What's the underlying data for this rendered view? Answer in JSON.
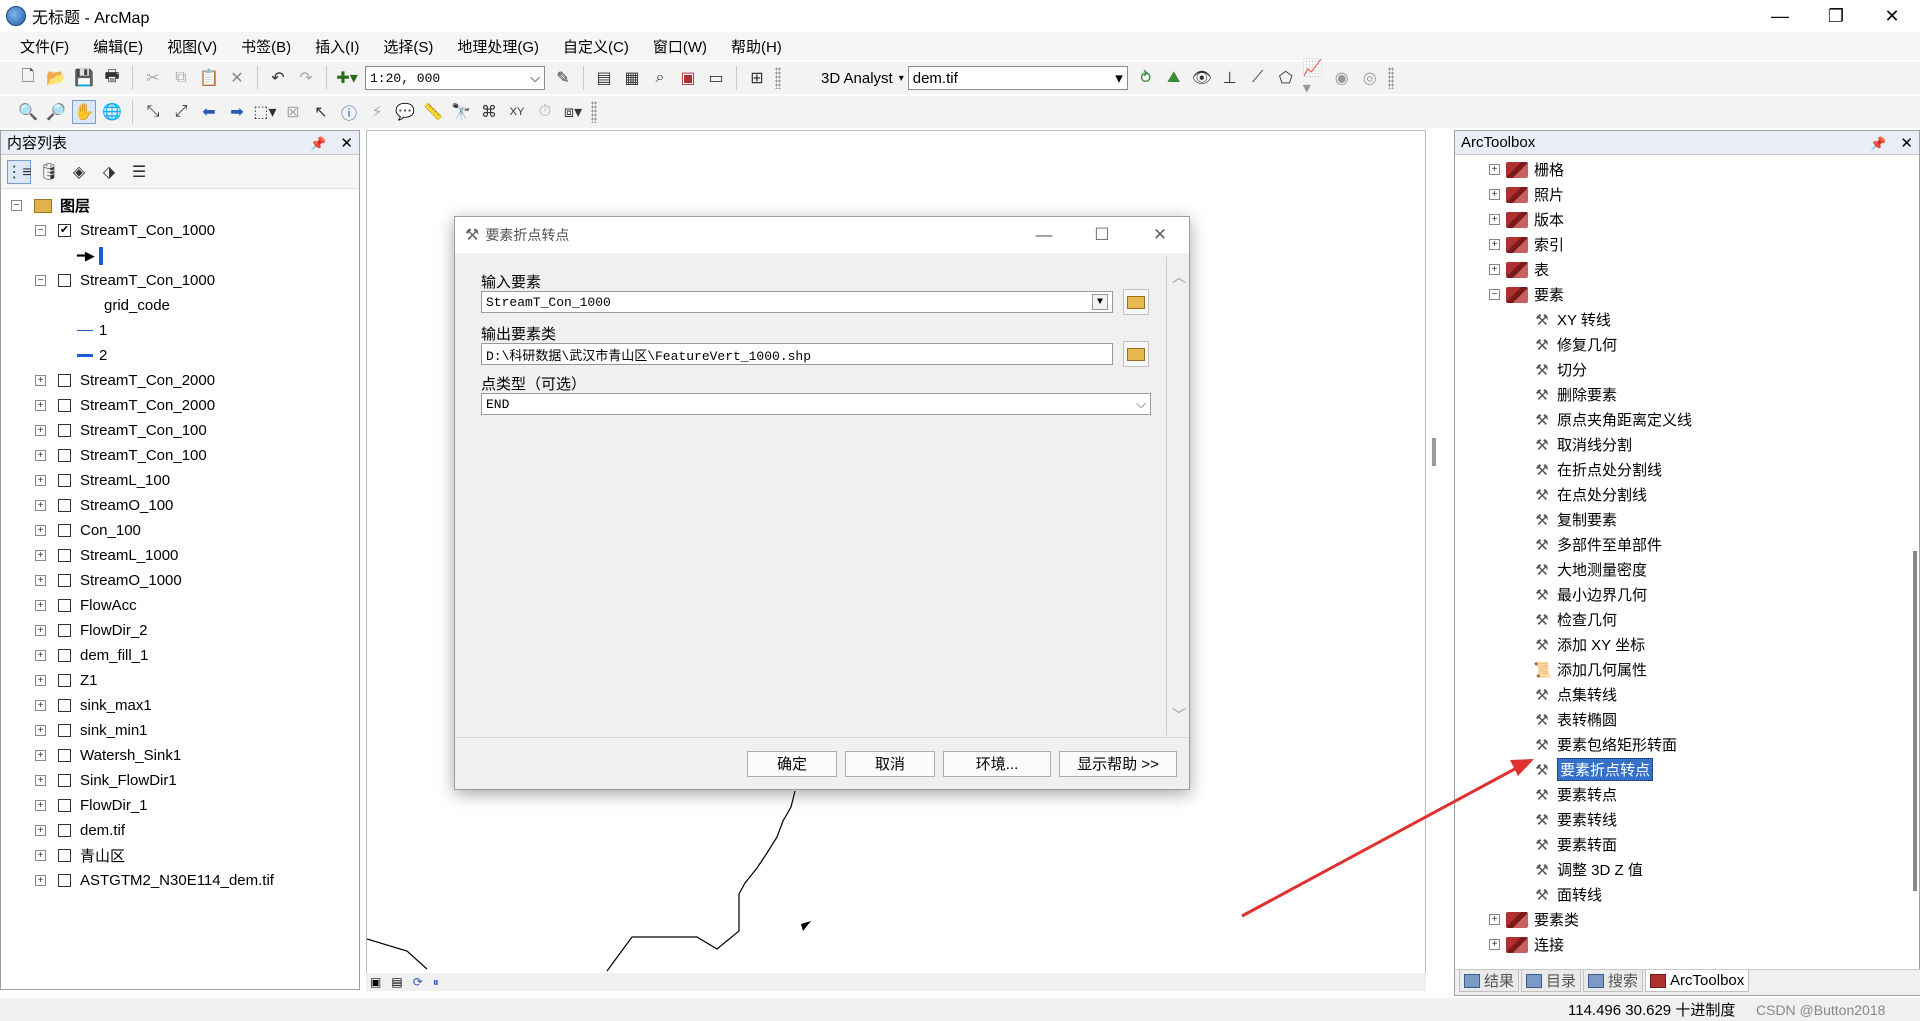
{
  "window": {
    "title": "无标题 - ArcMap",
    "minimize": "—",
    "restore": "❐",
    "close": "✕"
  },
  "menu": [
    "文件(F)",
    "编辑(E)",
    "视图(V)",
    "书签(B)",
    "插入(I)",
    "选择(S)",
    "地理处理(G)",
    "自定义(C)",
    "窗口(W)",
    "帮助(H)"
  ],
  "toolbar": {
    "scale": "1:20, 000",
    "analyst": "3D Analyst",
    "dem_layer": "dem.tif"
  },
  "toc": {
    "title": "内容列表",
    "root": "图层",
    "layers": [
      {
        "name": "StreamT_Con_1000",
        "checked": true,
        "expanded": true
      },
      {
        "name": "StreamT_Con_1000",
        "checked": false,
        "expanded": true
      },
      {
        "name": "StreamT_Con_2000",
        "checked": false
      },
      {
        "name": "StreamT_Con_2000",
        "checked": false
      },
      {
        "name": "StreamT_Con_100",
        "checked": false
      },
      {
        "name": "StreamT_Con_100",
        "checked": false
      },
      {
        "name": "StreamL_100",
        "checked": false
      },
      {
        "name": "StreamO_100",
        "checked": false
      },
      {
        "name": "Con_100",
        "checked": false
      },
      {
        "name": "StreamL_1000",
        "checked": false
      },
      {
        "name": "StreamO_1000",
        "checked": false
      },
      {
        "name": "FlowAcc",
        "checked": false
      },
      {
        "name": "FlowDir_2",
        "checked": false
      },
      {
        "name": "dem_fill_1",
        "checked": false
      },
      {
        "name": "Z1",
        "checked": false
      },
      {
        "name": "sink_max1",
        "checked": false
      },
      {
        "name": "sink_min1",
        "checked": false
      },
      {
        "name": "Watersh_Sink1",
        "checked": false
      },
      {
        "name": "Sink_FlowDir1",
        "checked": false
      },
      {
        "name": "FlowDir_1",
        "checked": false
      },
      {
        "name": "dem.tif",
        "checked": false
      },
      {
        "name": "青山区",
        "checked": false
      },
      {
        "name": "ASTGTM2_N30E114_dem.tif",
        "checked": false
      }
    ],
    "grid_code_label": "grid_code",
    "legend_values": [
      "1",
      "2"
    ]
  },
  "dialog": {
    "title": "要素折点转点",
    "input_label": "输入要素",
    "input_value": "StreamT_Con_1000",
    "output_label": "输出要素类",
    "output_value": "D:\\科研数据\\武汉市青山区\\FeatureVert_1000.shp",
    "point_type_label": "点类型（可选）",
    "point_type_value": "END",
    "ok": "确定",
    "cancel": "取消",
    "env": "环境...",
    "help": "显示帮助 >>"
  },
  "toolbox": {
    "title": "ArcToolbox",
    "toolsets_before": [
      "栅格",
      "照片",
      "版本",
      "索引",
      "表"
    ],
    "expanded_toolset": "要素",
    "tools": [
      "XY 转线",
      "修复几何",
      "切分",
      "删除要素",
      "原点夹角距离定义线",
      "取消线分割",
      "在折点处分割线",
      "在点处分割线",
      "复制要素",
      "多部件至单部件",
      "大地测量密度",
      "最小边界几何",
      "检查几何",
      "添加 XY 坐标",
      "添加几何属性",
      "点集转线",
      "表转椭圆",
      "要素包络矩形转面",
      "要素折点转点",
      "要素转点",
      "要素转线",
      "要素转面",
      "调整 3D Z 值",
      "面转线"
    ],
    "selected_tool": "要素折点转点",
    "toolsets_after": [
      "要素类",
      "连接"
    ],
    "tabs": [
      "结果",
      "目录",
      "搜索",
      "ArcToolbox"
    ]
  },
  "status": {
    "coords": "114.496  30.629 十进制度",
    "watermark": "CSDN @Button2018"
  }
}
